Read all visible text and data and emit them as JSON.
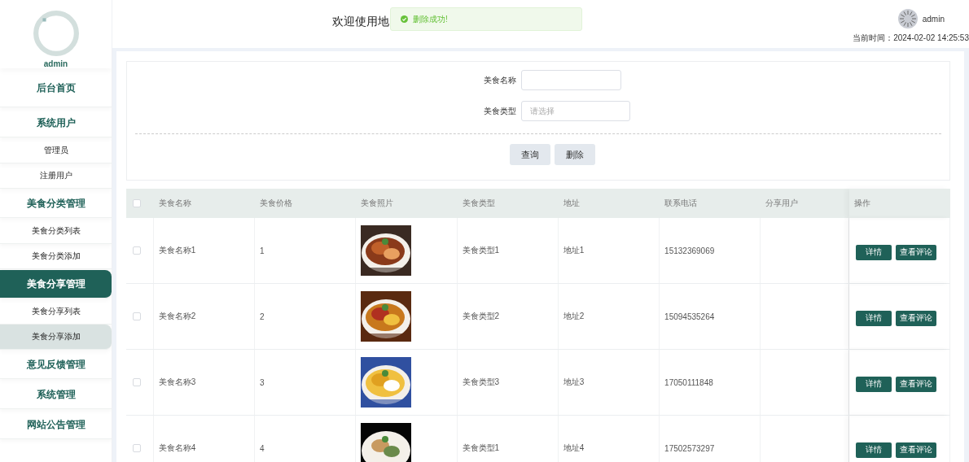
{
  "sidebar": {
    "user": "admin",
    "items": [
      {
        "label": "后台首页",
        "kind": "top",
        "selected": false,
        "highlighted": false
      },
      {
        "label": "系统用户",
        "kind": "top",
        "selected": false,
        "highlighted": false
      },
      {
        "label": "管理员",
        "kind": "sub",
        "selected": false,
        "highlighted": false
      },
      {
        "label": "注册用户",
        "kind": "sub",
        "selected": false,
        "highlighted": false
      },
      {
        "label": "美食分类管理",
        "kind": "top",
        "selected": false,
        "highlighted": false
      },
      {
        "label": "美食分类列表",
        "kind": "sub",
        "selected": false,
        "highlighted": false
      },
      {
        "label": "美食分类添加",
        "kind": "sub",
        "selected": false,
        "highlighted": false
      },
      {
        "label": "美食分享管理",
        "kind": "top",
        "selected": true,
        "highlighted": false
      },
      {
        "label": "美食分享列表",
        "kind": "sub",
        "selected": false,
        "highlighted": false
      },
      {
        "label": "美食分享添加",
        "kind": "sub",
        "selected": false,
        "highlighted": true
      },
      {
        "label": "意见反馈管理",
        "kind": "top",
        "selected": false,
        "highlighted": false
      },
      {
        "label": "系统管理",
        "kind": "top",
        "selected": false,
        "highlighted": false
      },
      {
        "label": "网站公告管理",
        "kind": "top",
        "selected": false,
        "highlighted": false
      }
    ]
  },
  "header": {
    "title": "欢迎使用地",
    "toast": "删除成功!",
    "user": "admin",
    "time_label": "当前时间：",
    "time": "2024-02-02 14:25:53"
  },
  "search": {
    "fields": [
      {
        "label": "美食名称",
        "kind": "input"
      },
      {
        "label": "美食类型",
        "kind": "select",
        "placeholder": "请选择"
      }
    ],
    "buttons": [
      "查询",
      "删除"
    ]
  },
  "table": {
    "all_checked": false,
    "columns": [
      "美食名称",
      "美食价格",
      "美食照片",
      "美食类型",
      "地址",
      "联系电话",
      "分享用户",
      "操作"
    ],
    "rows": [
      {
        "checked": false,
        "name": "美食名称1",
        "price": "1",
        "type": "美食类型1",
        "address": "地址1",
        "phone": "15132369069",
        "actions": [
          "详情",
          "查看评论"
        ]
      },
      {
        "checked": false,
        "name": "美食名称2",
        "price": "2",
        "type": "美食类型2",
        "address": "地址2",
        "phone": "15094535264",
        "actions": [
          "详情",
          "查看评论"
        ]
      },
      {
        "checked": false,
        "name": "美食名称3",
        "price": "3",
        "type": "美食类型3",
        "address": "地址3",
        "phone": "17050111848",
        "actions": [
          "详情",
          "查看评论"
        ]
      },
      {
        "checked": false,
        "name": "美食名称4",
        "price": "4",
        "type": "美食类型1",
        "address": "地址4",
        "phone": "17502573297",
        "actions": [
          "详情",
          "查看评论"
        ]
      }
    ]
  }
}
